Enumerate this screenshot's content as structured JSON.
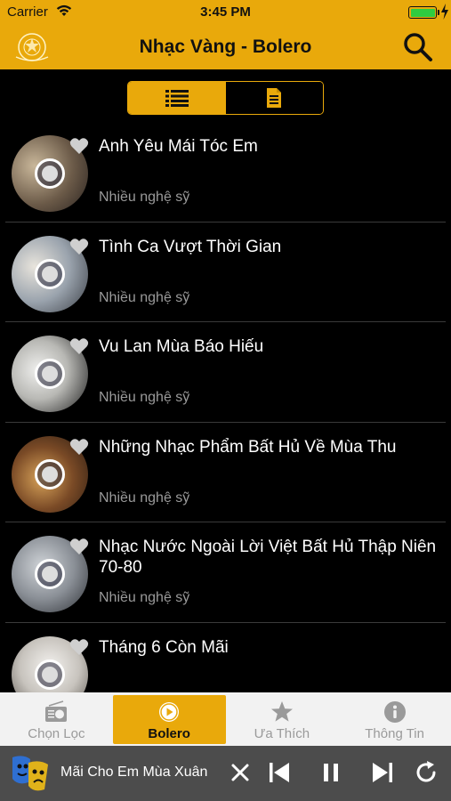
{
  "status_bar": {
    "carrier": "Carrier",
    "time": "3:45 PM",
    "battery_level": 1.0
  },
  "header": {
    "title": "Nhạc Vàng - Bolero",
    "logo_icon": "gold-disc-logo-icon",
    "search_icon": "search-icon"
  },
  "view_toggle": {
    "active": "list",
    "options": [
      "list-view-icon",
      "document-view-icon"
    ]
  },
  "songs": [
    {
      "title": "Anh Yêu Mái Tóc Em",
      "artist": "Nhiều nghệ sỹ"
    },
    {
      "title": "Tình Ca Vượt Thời Gian",
      "artist": "Nhiều nghệ sỹ"
    },
    {
      "title": "Vu Lan Mùa Báo Hiếu",
      "artist": "Nhiều nghệ sỹ"
    },
    {
      "title": "Những Nhạc Phẩm Bất Hủ Về Mùa Thu",
      "artist": "Nhiều nghệ sỹ"
    },
    {
      "title": "Nhạc Nước Ngoài Lời Việt Bất Hủ Thập Niên 70-80",
      "artist": "Nhiều nghệ sỹ"
    },
    {
      "title": "Tháng 6 Còn Mãi",
      "artist": ""
    }
  ],
  "tabs": [
    {
      "label": "Chọn Lọc",
      "icon": "radio-icon",
      "active": false
    },
    {
      "label": "Bolero",
      "icon": "play-circle-icon",
      "active": true
    },
    {
      "label": "Ưa Thích",
      "icon": "star-icon",
      "active": false
    },
    {
      "label": "Thông Tin",
      "icon": "info-icon",
      "active": false
    }
  ],
  "player": {
    "now_playing": "Mãi Cho Em Mùa Xuân"
  },
  "colors": {
    "accent": "#E9A90B",
    "background": "#000000",
    "player_bg": "#4C4C4C",
    "tabbar_bg": "#F2F2F2"
  }
}
